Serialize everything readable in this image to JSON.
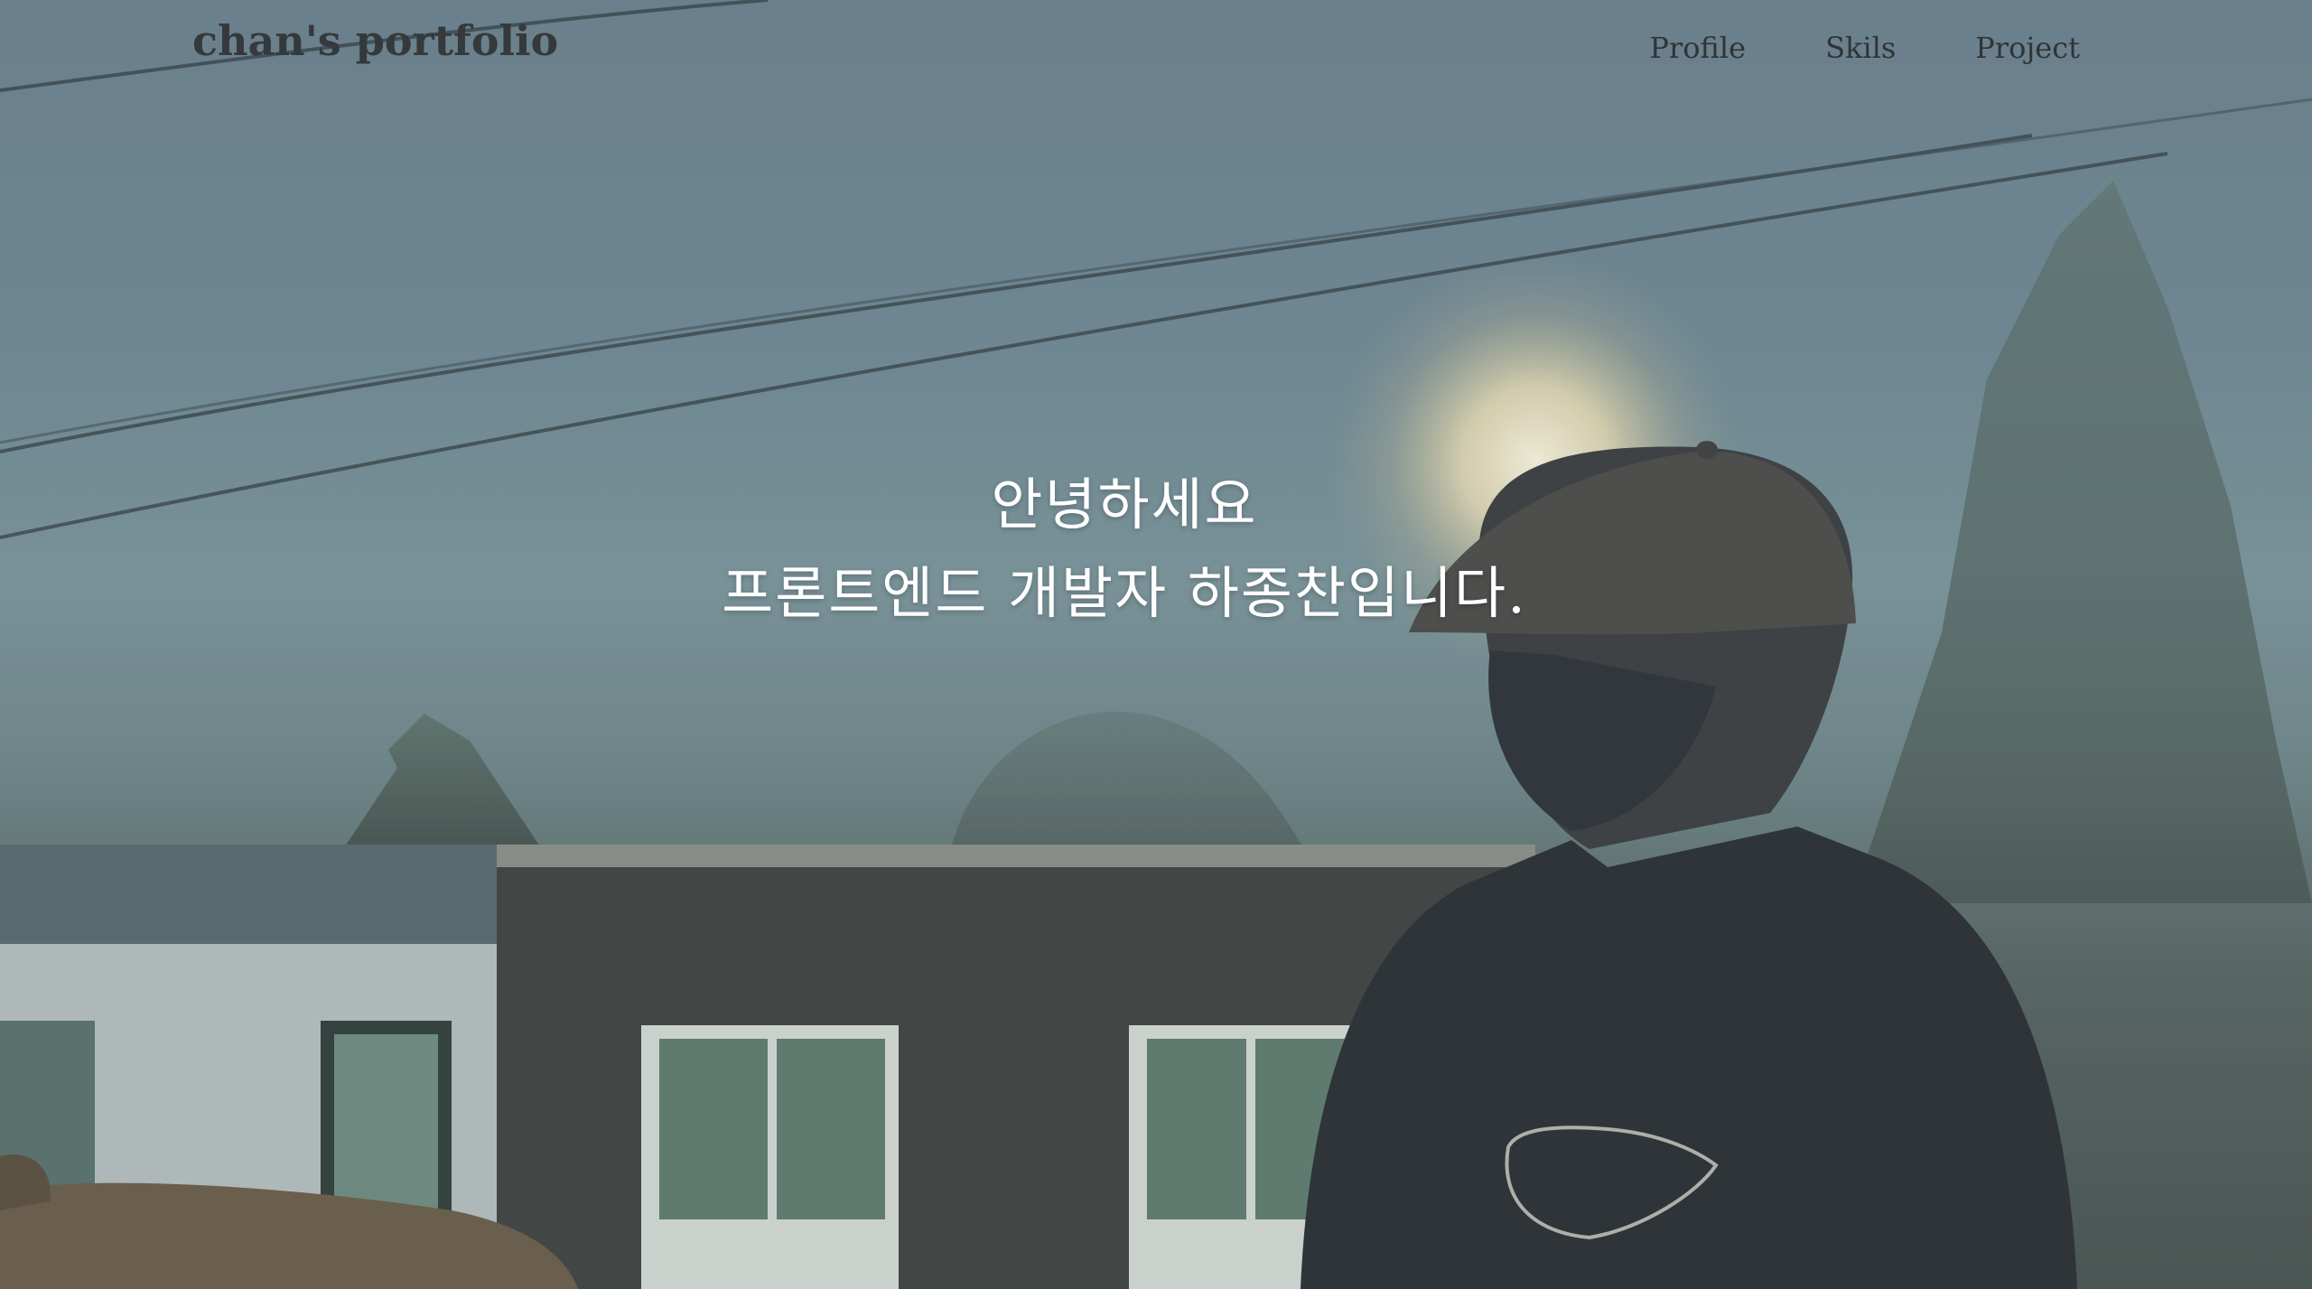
{
  "brand": {
    "title": "chan's portfolio"
  },
  "nav": {
    "items": [
      {
        "label": "Profile"
      },
      {
        "label": "Skils"
      },
      {
        "label": "Project"
      }
    ]
  },
  "hero": {
    "greeting": "안녕하세요",
    "intro": "프론트엔드 개발자 하종찬입니다."
  },
  "colors": {
    "brand_text": "#35393b",
    "nav_text": "#2f3436",
    "headline_text": "#ffffff"
  }
}
